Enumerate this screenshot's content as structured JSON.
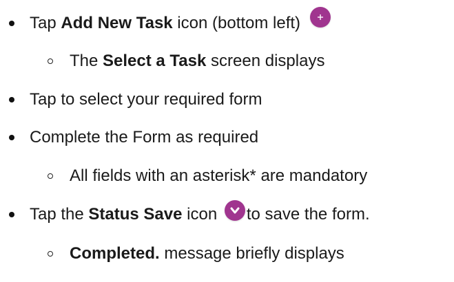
{
  "items": [
    {
      "pre": "Tap ",
      "bold": "Add New Task",
      "post": " icon (bottom left)",
      "icon": "add-task-plus-icon"
    },
    {
      "bold": "The ",
      "boldText": "Select a Task",
      "post": " screen displays"
    },
    {
      "text": "Tap to select your required form"
    },
    {
      "text": "Complete the Form as required"
    },
    {
      "text": "All fields with an asterisk* are mandatory"
    },
    {
      "pre": "Tap the ",
      "bold": "Status Save",
      "mid": " icon ",
      "post": "to save the form.",
      "icon": "status-save-chevron-icon"
    },
    {
      "bold": "Completed.",
      "post": " message briefly displays"
    }
  ],
  "colors": {
    "icon_bg": "#a0358f",
    "text": "#1a1a1a"
  }
}
